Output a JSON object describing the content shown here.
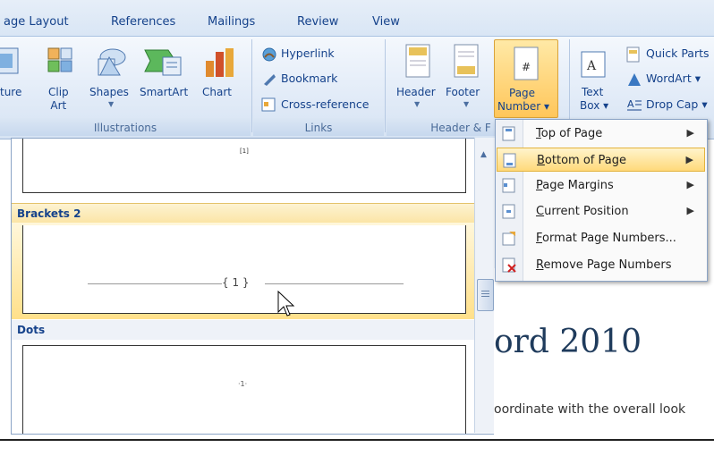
{
  "tabs": [
    "age Layout",
    "References",
    "Mailings",
    "Review",
    "View"
  ],
  "illustrations": {
    "buttons": [
      {
        "label": "ture"
      },
      {
        "label": "Clip\nArt"
      },
      {
        "label": "Shapes"
      },
      {
        "label": "SmartArt"
      },
      {
        "label": "Chart"
      }
    ],
    "group_label": "Illustrations"
  },
  "links": {
    "items": [
      "Hyperlink",
      "Bookmark",
      "Cross-reference"
    ],
    "group_label": "Links"
  },
  "header_footer": {
    "header_label": "Header",
    "footer_label": "Footer",
    "page_number_label_1": "Page",
    "page_number_label_2": "Number",
    "group_label": "Header & F"
  },
  "text_group": {
    "text_box_1": "Text",
    "text_box_2": "Box",
    "items": [
      "Quick Parts",
      "WordArt",
      "Drop Cap"
    ]
  },
  "gallery": {
    "top_mark": "[1]",
    "section_1": "Brackets 2",
    "bracket_text": "{ 1 }",
    "section_2": "Dots",
    "dots_mark": "·1·"
  },
  "menu": {
    "items": [
      {
        "label": "Top of Page",
        "accel": "T",
        "rest": "op of Page",
        "has_submenu": true
      },
      {
        "label": "Bottom of Page",
        "accel": "B",
        "rest": "ottom of Page",
        "has_submenu": true
      },
      {
        "label": "Page Margins",
        "accel": "P",
        "rest": "age Margins",
        "has_submenu": true
      },
      {
        "label": "Current Position",
        "accel": "C",
        "rest": "urrent Position",
        "has_submenu": true
      },
      {
        "label": "Format Page Numbers...",
        "accel": "F",
        "rest": "ormat Page Numbers...",
        "has_submenu": false
      },
      {
        "label": "Remove Page Numbers",
        "accel": "R",
        "rest": "emove Page Numbers",
        "has_submenu": false
      }
    ]
  },
  "document": {
    "heading": "ord 2010",
    "line1": "oordinate with the overall look"
  },
  "colors": {
    "highlight": "#ffd97a",
    "ribbon": "#dbe6f4",
    "text_blue": "#15428b"
  }
}
